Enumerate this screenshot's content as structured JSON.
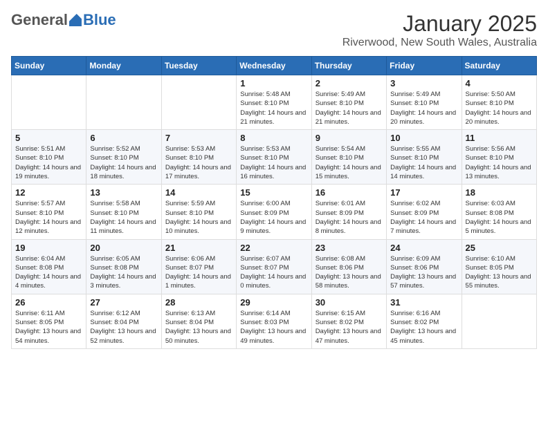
{
  "header": {
    "logo_general": "General",
    "logo_blue": "Blue",
    "month_title": "January 2025",
    "subtitle": "Riverwood, New South Wales, Australia"
  },
  "days_of_week": [
    "Sunday",
    "Monday",
    "Tuesday",
    "Wednesday",
    "Thursday",
    "Friday",
    "Saturday"
  ],
  "weeks": [
    [
      {
        "day": "",
        "info": ""
      },
      {
        "day": "",
        "info": ""
      },
      {
        "day": "",
        "info": ""
      },
      {
        "day": "1",
        "info": "Sunrise: 5:48 AM\nSunset: 8:10 PM\nDaylight: 14 hours and 21 minutes."
      },
      {
        "day": "2",
        "info": "Sunrise: 5:49 AM\nSunset: 8:10 PM\nDaylight: 14 hours and 21 minutes."
      },
      {
        "day": "3",
        "info": "Sunrise: 5:49 AM\nSunset: 8:10 PM\nDaylight: 14 hours and 20 minutes."
      },
      {
        "day": "4",
        "info": "Sunrise: 5:50 AM\nSunset: 8:10 PM\nDaylight: 14 hours and 20 minutes."
      }
    ],
    [
      {
        "day": "5",
        "info": "Sunrise: 5:51 AM\nSunset: 8:10 PM\nDaylight: 14 hours and 19 minutes."
      },
      {
        "day": "6",
        "info": "Sunrise: 5:52 AM\nSunset: 8:10 PM\nDaylight: 14 hours and 18 minutes."
      },
      {
        "day": "7",
        "info": "Sunrise: 5:53 AM\nSunset: 8:10 PM\nDaylight: 14 hours and 17 minutes."
      },
      {
        "day": "8",
        "info": "Sunrise: 5:53 AM\nSunset: 8:10 PM\nDaylight: 14 hours and 16 minutes."
      },
      {
        "day": "9",
        "info": "Sunrise: 5:54 AM\nSunset: 8:10 PM\nDaylight: 14 hours and 15 minutes."
      },
      {
        "day": "10",
        "info": "Sunrise: 5:55 AM\nSunset: 8:10 PM\nDaylight: 14 hours and 14 minutes."
      },
      {
        "day": "11",
        "info": "Sunrise: 5:56 AM\nSunset: 8:10 PM\nDaylight: 14 hours and 13 minutes."
      }
    ],
    [
      {
        "day": "12",
        "info": "Sunrise: 5:57 AM\nSunset: 8:10 PM\nDaylight: 14 hours and 12 minutes."
      },
      {
        "day": "13",
        "info": "Sunrise: 5:58 AM\nSunset: 8:10 PM\nDaylight: 14 hours and 11 minutes."
      },
      {
        "day": "14",
        "info": "Sunrise: 5:59 AM\nSunset: 8:10 PM\nDaylight: 14 hours and 10 minutes."
      },
      {
        "day": "15",
        "info": "Sunrise: 6:00 AM\nSunset: 8:09 PM\nDaylight: 14 hours and 9 minutes."
      },
      {
        "day": "16",
        "info": "Sunrise: 6:01 AM\nSunset: 8:09 PM\nDaylight: 14 hours and 8 minutes."
      },
      {
        "day": "17",
        "info": "Sunrise: 6:02 AM\nSunset: 8:09 PM\nDaylight: 14 hours and 7 minutes."
      },
      {
        "day": "18",
        "info": "Sunrise: 6:03 AM\nSunset: 8:08 PM\nDaylight: 14 hours and 5 minutes."
      }
    ],
    [
      {
        "day": "19",
        "info": "Sunrise: 6:04 AM\nSunset: 8:08 PM\nDaylight: 14 hours and 4 minutes."
      },
      {
        "day": "20",
        "info": "Sunrise: 6:05 AM\nSunset: 8:08 PM\nDaylight: 14 hours and 3 minutes."
      },
      {
        "day": "21",
        "info": "Sunrise: 6:06 AM\nSunset: 8:07 PM\nDaylight: 14 hours and 1 minutes."
      },
      {
        "day": "22",
        "info": "Sunrise: 6:07 AM\nSunset: 8:07 PM\nDaylight: 14 hours and 0 minutes."
      },
      {
        "day": "23",
        "info": "Sunrise: 6:08 AM\nSunset: 8:06 PM\nDaylight: 13 hours and 58 minutes."
      },
      {
        "day": "24",
        "info": "Sunrise: 6:09 AM\nSunset: 8:06 PM\nDaylight: 13 hours and 57 minutes."
      },
      {
        "day": "25",
        "info": "Sunrise: 6:10 AM\nSunset: 8:05 PM\nDaylight: 13 hours and 55 minutes."
      }
    ],
    [
      {
        "day": "26",
        "info": "Sunrise: 6:11 AM\nSunset: 8:05 PM\nDaylight: 13 hours and 54 minutes."
      },
      {
        "day": "27",
        "info": "Sunrise: 6:12 AM\nSunset: 8:04 PM\nDaylight: 13 hours and 52 minutes."
      },
      {
        "day": "28",
        "info": "Sunrise: 6:13 AM\nSunset: 8:04 PM\nDaylight: 13 hours and 50 minutes."
      },
      {
        "day": "29",
        "info": "Sunrise: 6:14 AM\nSunset: 8:03 PM\nDaylight: 13 hours and 49 minutes."
      },
      {
        "day": "30",
        "info": "Sunrise: 6:15 AM\nSunset: 8:02 PM\nDaylight: 13 hours and 47 minutes."
      },
      {
        "day": "31",
        "info": "Sunrise: 6:16 AM\nSunset: 8:02 PM\nDaylight: 13 hours and 45 minutes."
      },
      {
        "day": "",
        "info": ""
      }
    ]
  ]
}
